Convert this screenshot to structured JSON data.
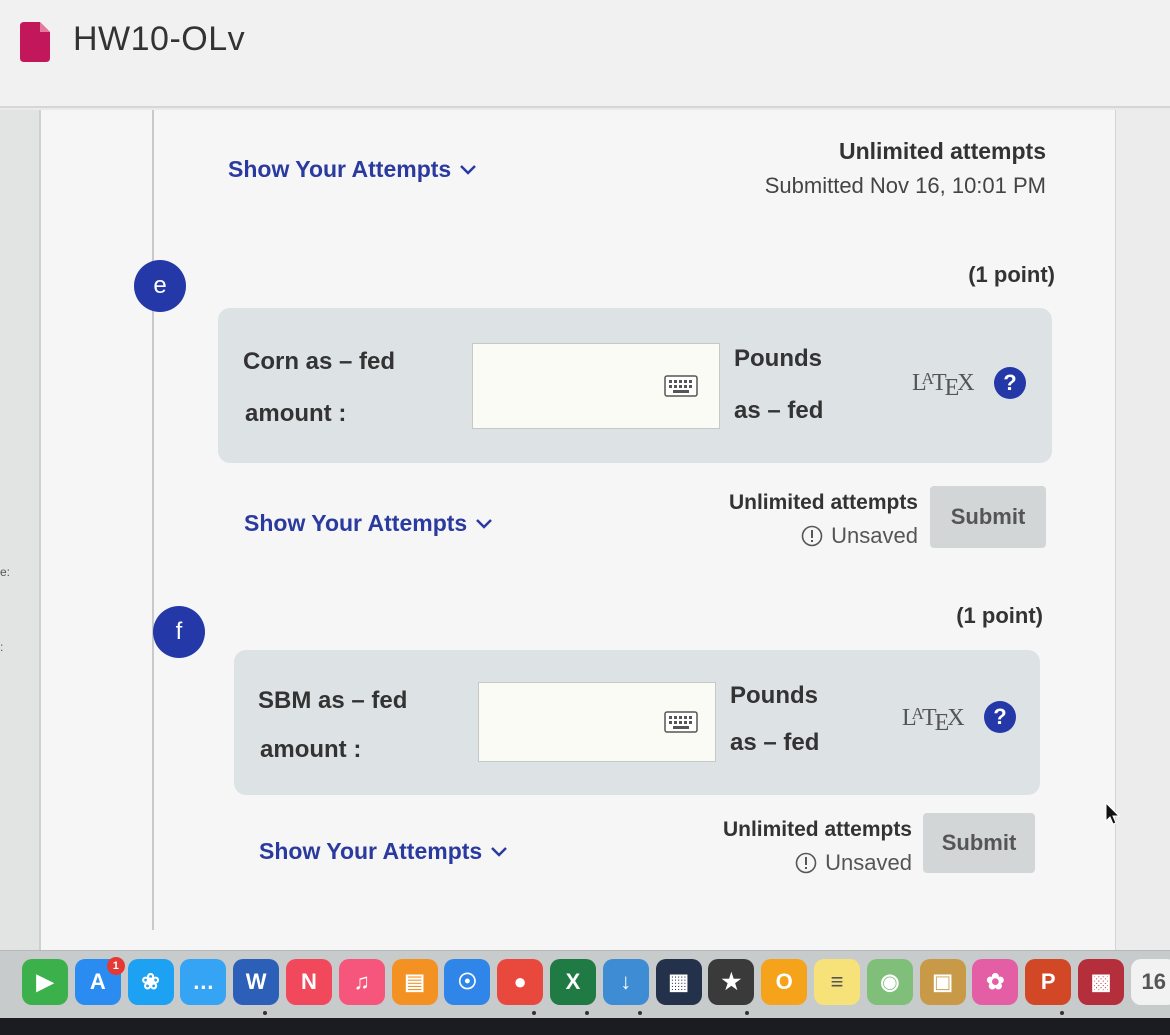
{
  "header": {
    "title": "HW10-OLv"
  },
  "left_strip": {
    "tags": [
      "e:",
      ":"
    ]
  },
  "top_block": {
    "attempts_link": "Show Your Attempts",
    "attempts_limit": "Unlimited attempts",
    "submitted": "Submitted Nov 16, 10:01 PM"
  },
  "part_e": {
    "badge": "e",
    "points": "(1 point)",
    "label_line1": "Corn as – fed",
    "label_line2": "amount :",
    "input_value": "",
    "unit_line1": "Pounds",
    "unit_line2": "as – fed",
    "latex": "LATEX",
    "help": "?",
    "attempts_link": "Show Your Attempts",
    "attempts_limit": "Unlimited attempts",
    "status": "Unsaved",
    "submit": "Submit"
  },
  "part_f": {
    "badge": "f",
    "points": "(1 point)",
    "label_line1": "SBM as – fed",
    "label_line2": "amount :",
    "input_value": "",
    "unit_line1": "Pounds",
    "unit_line2": "as – fed",
    "latex": "LATEX",
    "help": "?",
    "attempts_link": "Show Your Attempts",
    "attempts_limit": "Unlimited attempts",
    "status": "Unsaved",
    "submit": "Submit"
  },
  "dock": {
    "items": [
      {
        "name": "facetime-icon",
        "color": "#3cb04a",
        "glyph": "▶"
      },
      {
        "name": "app-store-icon",
        "color": "#2a8cf0",
        "glyph": "A",
        "badge": "1"
      },
      {
        "name": "twitter-icon",
        "color": "#1da1f2",
        "glyph": "❀"
      },
      {
        "name": "messages-icon",
        "color": "#35a4f5",
        "glyph": "…"
      },
      {
        "name": "word-icon",
        "color": "#2b5fb8",
        "glyph": "W"
      },
      {
        "name": "news-icon",
        "color": "#f2485c",
        "glyph": "N"
      },
      {
        "name": "music-icon",
        "color": "#f7567c",
        "glyph": "♫"
      },
      {
        "name": "books-icon",
        "color": "#f39222",
        "glyph": "▤"
      },
      {
        "name": "safari-icon",
        "color": "#2f86e8",
        "glyph": "☉"
      },
      {
        "name": "chrome-icon",
        "color": "#e9493d",
        "glyph": "●"
      },
      {
        "name": "excel-icon",
        "color": "#1f7a44",
        "glyph": "X"
      },
      {
        "name": "downloader-icon",
        "color": "#3e8cd4",
        "glyph": "↓"
      },
      {
        "name": "screen-icon",
        "color": "#23324a",
        "glyph": "▦"
      },
      {
        "name": "imovie-icon",
        "color": "#3a3a3a",
        "glyph": "★"
      },
      {
        "name": "office-icon",
        "color": "#f4a31a",
        "glyph": "O"
      },
      {
        "name": "notes-icon",
        "color": "#f7e27a",
        "glyph": "≡"
      },
      {
        "name": "maps-icon",
        "color": "#7fbf7a",
        "glyph": "◉"
      },
      {
        "name": "archive-icon",
        "color": "#c89a48",
        "glyph": "▣"
      },
      {
        "name": "photos-icon",
        "color": "#e45ea6",
        "glyph": "✿"
      },
      {
        "name": "powerpoint-icon",
        "color": "#d24726",
        "glyph": "P"
      },
      {
        "name": "photobooth-icon",
        "color": "#b52e3b",
        "glyph": "▩"
      },
      {
        "name": "calendar-icon",
        "color": "#f2f2f2",
        "glyph": "16"
      }
    ]
  }
}
